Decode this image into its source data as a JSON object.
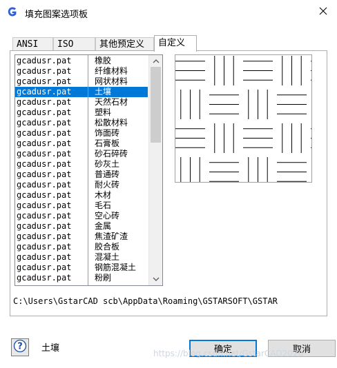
{
  "window": {
    "title": "填充图案选项板",
    "icon": "gstarcad-g-icon",
    "close_icon": "close-icon"
  },
  "tabs": [
    {
      "label": "ANSI",
      "active": false
    },
    {
      "label": "ISO",
      "active": false
    },
    {
      "label": "其他预定义",
      "active": false
    },
    {
      "label": "自定义",
      "active": true
    }
  ],
  "pattern_list": {
    "items": [
      {
        "file": "gcadusr.pat",
        "name": "橡胶"
      },
      {
        "file": "gcadusr.pat",
        "name": "纤维材料"
      },
      {
        "file": "gcadusr.pat",
        "name": "网状材料"
      },
      {
        "file": "gcadusr.pat",
        "name": "土壤"
      },
      {
        "file": "gcadusr.pat",
        "name": "天然石材"
      },
      {
        "file": "gcadusr.pat",
        "name": "塑料"
      },
      {
        "file": "gcadusr.pat",
        "name": "松散材料"
      },
      {
        "file": "gcadusr.pat",
        "name": "饰面砖"
      },
      {
        "file": "gcadusr.pat",
        "name": "石膏板"
      },
      {
        "file": "gcadusr.pat",
        "name": "砂石碎砖"
      },
      {
        "file": "gcadusr.pat",
        "name": "砂灰土"
      },
      {
        "file": "gcadusr.pat",
        "name": "普通砖"
      },
      {
        "file": "gcadusr.pat",
        "name": "耐火砖"
      },
      {
        "file": "gcadusr.pat",
        "name": "木材"
      },
      {
        "file": "gcadusr.pat",
        "name": "毛石"
      },
      {
        "file": "gcadusr.pat",
        "name": "空心砖"
      },
      {
        "file": "gcadusr.pat",
        "name": "金属"
      },
      {
        "file": "gcadusr.pat",
        "name": "焦渣矿渣"
      },
      {
        "file": "gcadusr.pat",
        "name": "胶合板"
      },
      {
        "file": "gcadusr.pat",
        "name": "混凝土"
      },
      {
        "file": "gcadusr.pat",
        "name": "钢筋混凝土"
      },
      {
        "file": "gcadusr.pat",
        "name": "粉刷"
      }
    ],
    "selected_index": 3,
    "scroll_up_icon": "chevron-up-icon",
    "scroll_down_icon": "chevron-down-icon"
  },
  "file_path": "C:\\Users\\GstarCAD scb\\AppData\\Roaming\\GSTARSOFT\\GSTAR",
  "footer": {
    "help_icon": "help-question-icon",
    "selected_pattern_name": "土壤",
    "ok_label": "确定",
    "cancel_label": "取消",
    "watermark": "https://blog.csdn.net/GstarCAD2020"
  },
  "colors": {
    "selection": "#0078d7",
    "logo": "#2f5fd8"
  }
}
